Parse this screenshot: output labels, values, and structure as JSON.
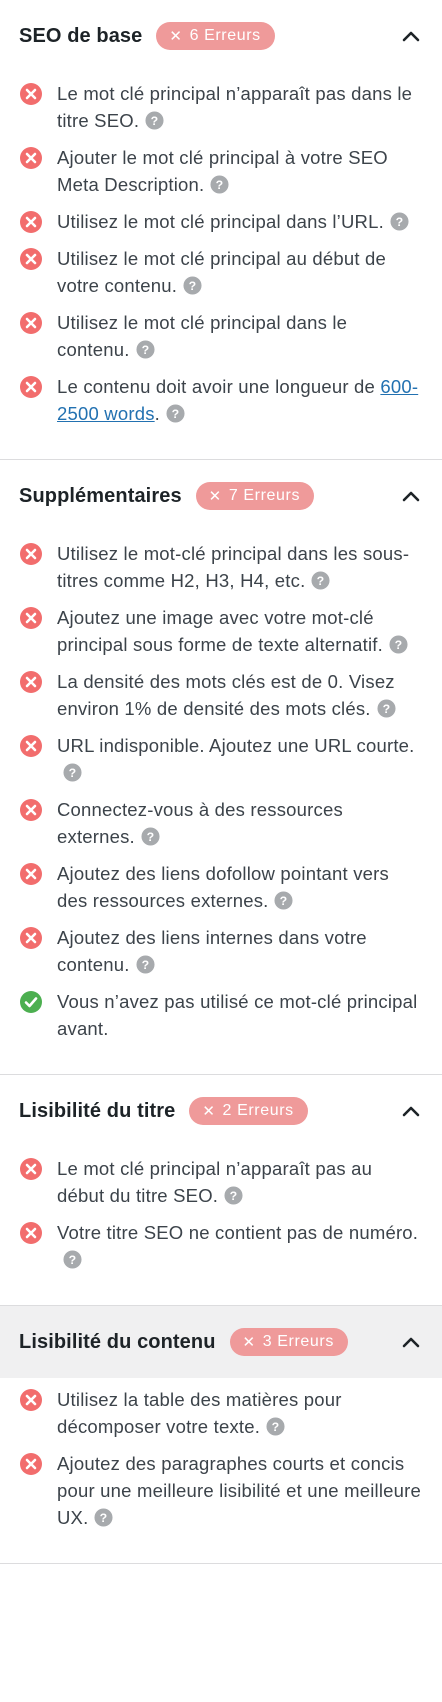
{
  "colors": {
    "error": "#f26d6d",
    "success": "#4caf50",
    "badge": "#ef9a9a",
    "help": "#a7aaad",
    "link": "#2271b1"
  },
  "icons": {
    "error": "x-circle-icon",
    "success": "check-circle-icon",
    "help": "question-circle-icon",
    "toggle": "chevron-up-icon"
  },
  "sections": [
    {
      "title": "SEO de base",
      "badge": "6 Erreurs",
      "checks": [
        {
          "status": "error",
          "text": "Le mot clé principal n’apparaît pas dans le titre SEO.",
          "help": true
        },
        {
          "status": "error",
          "text": "Ajouter le mot clé principal à votre SEO Meta Description.",
          "help": true
        },
        {
          "status": "error",
          "text": "Utilisez le mot clé principal dans l’URL.",
          "help": true
        },
        {
          "status": "error",
          "text": "Utilisez le mot clé principal au début de votre contenu.",
          "help": true
        },
        {
          "status": "error",
          "text": "Utilisez le mot clé principal dans le contenu.",
          "help": true
        },
        {
          "status": "error",
          "text": "Le contenu doit avoir une longueur de ",
          "link": "600-2500 words",
          "after": ".",
          "help": true
        }
      ]
    },
    {
      "title": "Supplémentaires",
      "badge": "7 Erreurs",
      "checks": [
        {
          "status": "error",
          "text": "Utilisez le mot-clé principal dans les sous-titres comme H2, H3, H4, etc.",
          "help": true
        },
        {
          "status": "error",
          "text": "Ajoutez une image avec votre mot-clé principal sous forme de texte alternatif.",
          "help": true
        },
        {
          "status": "error",
          "text": "La densité des mots clés est de 0. Visez environ 1% de densité des mots clés.",
          "help": true
        },
        {
          "status": "error",
          "text": "URL indisponible. Ajoutez une URL courte.",
          "help": true
        },
        {
          "status": "error",
          "text": "Connectez-vous à des ressources externes.",
          "help": true
        },
        {
          "status": "error",
          "text": "Ajoutez des liens dofollow pointant vers des ressources externes.",
          "help": true
        },
        {
          "status": "error",
          "text": "Ajoutez des liens internes dans votre contenu.",
          "help": true
        },
        {
          "status": "success",
          "text": "Vous n’avez pas utilisé ce mot-clé principal avant.",
          "help": false
        }
      ]
    },
    {
      "title": "Lisibilité du titre",
      "badge": "2 Erreurs",
      "checks": [
        {
          "status": "error",
          "text": "Le mot clé principal n’apparaît pas au début du titre SEO.",
          "help": true
        },
        {
          "status": "error",
          "text": "Votre titre SEO ne contient pas de numéro.",
          "help": true
        }
      ]
    },
    {
      "title": "Lisibilité du contenu",
      "badge": "3 Erreurs",
      "shaded": true,
      "checks": [
        {
          "status": "error",
          "text": "Utilisez la table des matières pour décomposer votre texte.",
          "help": true
        },
        {
          "status": "error",
          "text": "Ajoutez des paragraphes courts et concis pour une meilleure lisibilité et une meilleure UX.",
          "help": true
        }
      ]
    }
  ]
}
